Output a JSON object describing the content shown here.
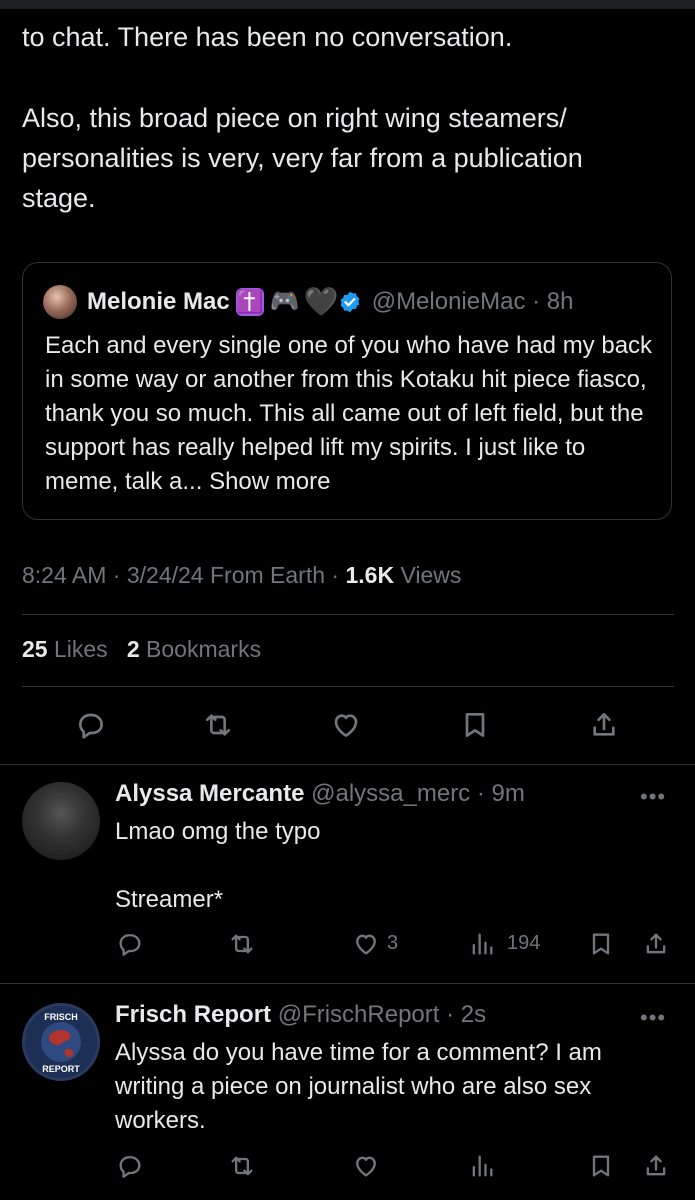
{
  "tweet": {
    "text_part1": "to chat. There has been no conversation.",
    "text_part2": "Also, this broad piece on right wing steamers/\npersonalities is very, very far from a publication\nstage."
  },
  "quote": {
    "name": "Melonie Mac",
    "emojis": [
      "✝️",
      "🎮",
      "🖤"
    ],
    "handle": "@MelonieMac",
    "time": "8h",
    "body": "Each and every single one of you who have had my back in some way or another from this Kotaku hit piece fiasco, thank you so much. This all came out of left field, but the support has really helped lift my spirits. I just like to meme, talk a...",
    "show_more": "Show more"
  },
  "meta": {
    "time": "8:24 AM",
    "date": "3/24/24",
    "source": "From Earth",
    "views_count": "1.6K",
    "views_label": "Views"
  },
  "stats": {
    "likes_count": "25",
    "likes_label": "Likes",
    "bookmarks_count": "2",
    "bookmarks_label": "Bookmarks"
  },
  "replies": [
    {
      "name": "Alyssa Mercante",
      "handle": "@alyssa_merc",
      "time": "9m",
      "body": "Lmao omg the typo\n\nStreamer*",
      "likes": "3",
      "views": "194"
    },
    {
      "name": "Frisch Report",
      "handle": "@FrischReport",
      "time": "2s",
      "body": "Alyssa do you have time for a comment? I am writing a piece on journalist who are also sex workers.",
      "avatar_text_top": "FRISCH",
      "avatar_text_bottom": "REPORT"
    }
  ],
  "icons": [
    "reply-icon",
    "retweet-icon",
    "like-icon",
    "bookmark-icon",
    "share-icon",
    "views-icon",
    "more-icon",
    "verified-icon"
  ],
  "colors": {
    "background": "#000000",
    "text": "#e7e9ea",
    "muted": "#71767b",
    "border": "#2f3336",
    "verified": "#1d9bf0"
  },
  "separator": "·",
  "more_glyph": "•••"
}
